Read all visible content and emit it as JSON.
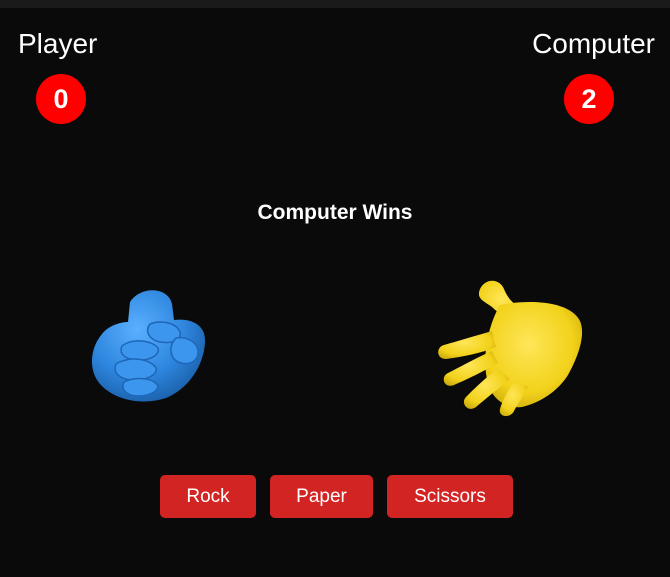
{
  "scoreboard": {
    "player_label": "Player",
    "computer_label": "Computer",
    "player_score": "0",
    "computer_score": "2"
  },
  "result_text": "Computer Wins",
  "hands": {
    "player_choice": "rock",
    "computer_choice": "paper",
    "player_color": "#2e86de",
    "computer_color": "#f2d21b"
  },
  "buttons": {
    "rock": "Rock",
    "paper": "Paper",
    "scissors": "Scissors"
  },
  "colors": {
    "background": "#0a0a0a",
    "score_badge": "#ff0000",
    "button": "#d32424"
  }
}
